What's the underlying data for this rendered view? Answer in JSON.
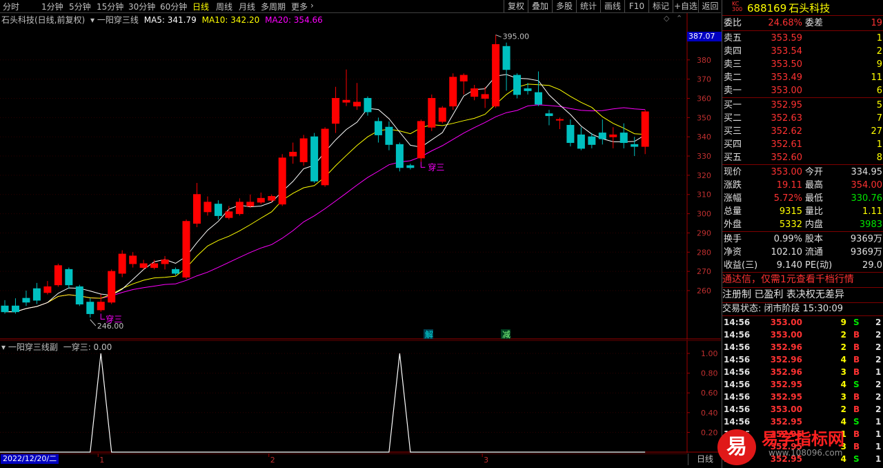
{
  "toolbar": {
    "periods": [
      "分时",
      "1分钟",
      "5分钟",
      "15分钟",
      "30分钟",
      "60分钟",
      "日线",
      "周线",
      "月线",
      "多周期",
      "更多"
    ],
    "active_period": "日线",
    "buttons": [
      "复权",
      "叠加",
      "多股",
      "统计",
      "画线",
      "F10",
      "标记",
      "+自选",
      "返回"
    ]
  },
  "chart": {
    "header_title": "石头科技(日线,前复权)",
    "indicator_name": "一阳穿三线",
    "ma5_label": "MA5: 341.79",
    "ma10_label": "MA10: 342.20",
    "ma20_label": "MA20: 354.66",
    "price_tag": "387.07",
    "high_mark": "395.00",
    "low_mark": "246.00",
    "signal_label": "穿三",
    "event_jie": "解",
    "event_jian": "减",
    "colors": {
      "up": "#ff0000",
      "down": "#00c0c0",
      "ma5": "#ffffff",
      "ma10": "#ffff00",
      "ma20": "#ff00ff"
    }
  },
  "chart_data": {
    "type": "candlestick",
    "y_ticks": [
      260,
      270,
      280,
      290,
      300,
      310,
      320,
      330,
      340,
      350,
      360,
      370,
      380
    ],
    "ylim": [
      246,
      395
    ],
    "candles": [
      {
        "o": 252,
        "c": 249,
        "h": 255,
        "l": 248
      },
      {
        "o": 252,
        "c": 249,
        "h": 256,
        "l": 248
      },
      {
        "o": 256,
        "c": 254,
        "h": 260,
        "l": 252
      },
      {
        "o": 261,
        "c": 255,
        "h": 264,
        "l": 253
      },
      {
        "o": 259,
        "c": 262,
        "h": 265,
        "l": 258
      },
      {
        "o": 263,
        "c": 273,
        "h": 274,
        "l": 262
      },
      {
        "o": 271,
        "c": 263,
        "h": 272,
        "l": 261
      },
      {
        "o": 262,
        "c": 253,
        "h": 263,
        "l": 252
      },
      {
        "o": 254,
        "c": 248,
        "h": 256,
        "l": 246
      },
      {
        "o": 250,
        "c": 254,
        "h": 258,
        "l": 249
      },
      {
        "o": 254,
        "c": 270,
        "h": 271,
        "l": 253
      },
      {
        "o": 269,
        "c": 279,
        "h": 281,
        "l": 267
      },
      {
        "o": 274,
        "c": 278,
        "h": 280,
        "l": 272
      },
      {
        "o": 272,
        "c": 274,
        "h": 276,
        "l": 271
      },
      {
        "o": 272,
        "c": 274,
        "h": 276,
        "l": 271
      },
      {
        "o": 274,
        "c": 276,
        "h": 278,
        "l": 271
      },
      {
        "o": 271,
        "c": 269,
        "h": 272,
        "l": 268
      },
      {
        "o": 267,
        "c": 296,
        "h": 297,
        "l": 266
      },
      {
        "o": 295,
        "c": 310,
        "h": 316,
        "l": 293
      },
      {
        "o": 301,
        "c": 306,
        "h": 309,
        "l": 299
      },
      {
        "o": 305,
        "c": 299,
        "h": 307,
        "l": 297
      },
      {
        "o": 298,
        "c": 301,
        "h": 304,
        "l": 297
      },
      {
        "o": 300,
        "c": 306,
        "h": 308,
        "l": 299
      },
      {
        "o": 304,
        "c": 306,
        "h": 310,
        "l": 303
      },
      {
        "o": 306,
        "c": 308,
        "h": 311,
        "l": 305
      },
      {
        "o": 307,
        "c": 309,
        "h": 310,
        "l": 306
      },
      {
        "o": 305,
        "c": 329,
        "h": 331,
        "l": 304
      },
      {
        "o": 330,
        "c": 332,
        "h": 337,
        "l": 326
      },
      {
        "o": 327,
        "c": 339,
        "h": 341,
        "l": 325
      },
      {
        "o": 340,
        "c": 317,
        "h": 342,
        "l": 316
      },
      {
        "o": 315,
        "c": 344,
        "h": 345,
        "l": 314
      },
      {
        "o": 347,
        "c": 360,
        "h": 366,
        "l": 342
      },
      {
        "o": 358,
        "c": 359,
        "h": 375,
        "l": 356
      },
      {
        "o": 356,
        "c": 358,
        "h": 368,
        "l": 354
      },
      {
        "o": 360,
        "c": 353,
        "h": 361,
        "l": 351
      },
      {
        "o": 348,
        "c": 341,
        "h": 350,
        "l": 337
      },
      {
        "o": 345,
        "c": 336,
        "h": 348,
        "l": 333
      },
      {
        "o": 336,
        "c": 324,
        "h": 337,
        "l": 322
      },
      {
        "o": 325,
        "c": 324,
        "h": 326,
        "l": 323
      },
      {
        "o": 329,
        "c": 348,
        "h": 349,
        "l": 327
      },
      {
        "o": 345,
        "c": 360,
        "h": 362,
        "l": 343
      },
      {
        "o": 348,
        "c": 355,
        "h": 356,
        "l": 347
      },
      {
        "o": 356,
        "c": 371,
        "h": 373,
        "l": 354
      },
      {
        "o": 369,
        "c": 372,
        "h": 373,
        "l": 362
      },
      {
        "o": 361,
        "c": 365,
        "h": 367,
        "l": 359
      },
      {
        "o": 360,
        "c": 362,
        "h": 366,
        "l": 355
      },
      {
        "o": 356,
        "c": 388,
        "h": 393,
        "l": 355
      },
      {
        "o": 387,
        "c": 375,
        "h": 389,
        "l": 364
      },
      {
        "o": 372,
        "c": 362,
        "h": 373,
        "l": 360
      },
      {
        "o": 365,
        "c": 364,
        "h": 368,
        "l": 362
      },
      {
        "o": 363,
        "c": 357,
        "h": 374,
        "l": 356
      },
      {
        "o": 352,
        "c": 351,
        "h": 354,
        "l": 346
      },
      {
        "o": 349,
        "c": 349,
        "h": 350,
        "l": 344
      },
      {
        "o": 346,
        "c": 337,
        "h": 349,
        "l": 335
      },
      {
        "o": 341,
        "c": 334,
        "h": 345,
        "l": 333
      },
      {
        "o": 340,
        "c": 336,
        "h": 342,
        "l": 334
      },
      {
        "o": 342,
        "c": 339,
        "h": 349,
        "l": 336
      },
      {
        "o": 340,
        "c": 341,
        "h": 345,
        "l": 334
      },
      {
        "o": 342,
        "c": 337,
        "h": 347,
        "l": 334
      },
      {
        "o": 336,
        "c": 335,
        "h": 340,
        "l": 330
      },
      {
        "o": 335,
        "c": 353,
        "h": 354,
        "l": 331
      }
    ],
    "sub": {
      "name": "一阳穿三线副",
      "series_label": "一穿三: 0.00",
      "y_ticks": [
        "1.00",
        "0.80",
        "0.60",
        "0.40",
        "0.20"
      ],
      "ylim": [
        0,
        1
      ],
      "peaks": [
        9,
        37
      ]
    },
    "x_labels": [
      {
        "text": "1",
        "i": 9
      },
      {
        "text": "2",
        "i": 25
      },
      {
        "text": "3",
        "i": 45
      }
    ],
    "date_label": "2022/12/20/二"
  },
  "quote": {
    "code": "688169",
    "name": "石头科技",
    "weibi_label": "委比",
    "weibi": "24.68%",
    "weicha_label": "委差",
    "weicha": "19",
    "sells": [
      {
        "label": "卖五",
        "price": "353.59",
        "vol": "1"
      },
      {
        "label": "卖四",
        "price": "353.54",
        "vol": "2"
      },
      {
        "label": "卖三",
        "price": "353.50",
        "vol": "9"
      },
      {
        "label": "卖二",
        "price": "353.49",
        "vol": "11"
      },
      {
        "label": "卖一",
        "price": "353.00",
        "vol": "6"
      }
    ],
    "buys": [
      {
        "label": "买一",
        "price": "352.95",
        "vol": "5"
      },
      {
        "label": "买二",
        "price": "352.63",
        "vol": "7"
      },
      {
        "label": "买三",
        "price": "352.62",
        "vol": "27"
      },
      {
        "label": "买四",
        "price": "352.61",
        "vol": "1"
      },
      {
        "label": "买五",
        "price": "352.60",
        "vol": "8"
      }
    ],
    "stats": [
      {
        "l1": "现价",
        "v1": "353.00",
        "c1": "red",
        "l2": "今开",
        "v2": "334.95",
        "c2": "wht"
      },
      {
        "l1": "涨跌",
        "v1": "19.11",
        "c1": "red",
        "l2": "最高",
        "v2": "354.00",
        "c2": "red"
      },
      {
        "l1": "涨幅",
        "v1": "5.72%",
        "c1": "red",
        "l2": "最低",
        "v2": "330.76",
        "c2": "green"
      },
      {
        "l1": "总量",
        "v1": "9315",
        "c1": "yel",
        "l2": "量比",
        "v2": "1.11",
        "c2": "yel"
      },
      {
        "l1": "外盘",
        "v1": "5332",
        "c1": "yel",
        "l2": "内盘",
        "v2": "3983",
        "c2": "green"
      }
    ],
    "fundamentals": [
      {
        "l1": "换手",
        "v1": "0.99%",
        "l2": "股本",
        "v2": "9369万"
      },
      {
        "l1": "净资",
        "v1": "102.10",
        "l2": "流通",
        "v2": "9369万"
      },
      {
        "l1": "收益(三)",
        "v1": "9.140",
        "l2": "PE(动)",
        "v2": "29.0"
      }
    ],
    "notice1": "通达信，仅需1元查看千档行情",
    "notice2": "注册制 已盈利 表决权无差异",
    "status": "交易状态: 闭市阶段 15:30:09",
    "ticks": [
      {
        "t": "14:56",
        "p": "353.00",
        "v": "9",
        "d": "S",
        "n": "2"
      },
      {
        "t": "14:56",
        "p": "353.00",
        "v": "2",
        "d": "B",
        "n": "2"
      },
      {
        "t": "14:56",
        "p": "352.96",
        "v": "2",
        "d": "B",
        "n": "2"
      },
      {
        "t": "14:56",
        "p": "352.96",
        "v": "4",
        "d": "B",
        "n": "2"
      },
      {
        "t": "14:56",
        "p": "352.96",
        "v": "3",
        "d": "B",
        "n": "1"
      },
      {
        "t": "14:56",
        "p": "352.95",
        "v": "4",
        "d": "S",
        "n": "2"
      },
      {
        "t": "14:56",
        "p": "352.95",
        "v": "3",
        "d": "B",
        "n": "2"
      },
      {
        "t": "14:56",
        "p": "353.00",
        "v": "2",
        "d": "B",
        "n": "2"
      },
      {
        "t": "14:56",
        "p": "352.95",
        "v": "4",
        "d": "S",
        "n": "1"
      },
      {
        "t": "14:56",
        "p": "352.95",
        "v": "1",
        "d": "B",
        "n": "1"
      },
      {
        "t": "14:56",
        "p": "352.95",
        "v": "3",
        "d": "B",
        "n": "1"
      },
      {
        "t": "14:56",
        "p": "352.95",
        "v": "4",
        "d": "S",
        "n": "1"
      }
    ],
    "bottom_tab": "日线"
  },
  "watermark": {
    "char": "易",
    "text": "易学指标网",
    "url": "www.108096.com"
  }
}
